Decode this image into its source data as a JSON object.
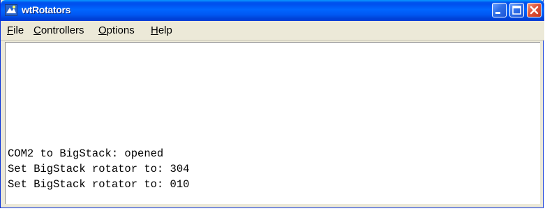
{
  "window": {
    "title": "wtRotators",
    "icon": "rotator-app-icon"
  },
  "title_buttons": {
    "minimize": "minimize-icon",
    "maximize": "maximize-icon",
    "close": "close-icon"
  },
  "menu": {
    "items": [
      {
        "mnemonic": "F",
        "rest": "ile"
      },
      {
        "mnemonic": "C",
        "rest": "ontrollers"
      },
      {
        "mnemonic": "O",
        "rest": "ptions"
      },
      {
        "mnemonic": "H",
        "rest": "elp"
      }
    ]
  },
  "log": {
    "lines": [
      "COM2 to BigStack: opened",
      "Set BigStack rotator to: 304",
      "Set BigStack rotator to: 010"
    ]
  },
  "colors": {
    "titlebar": "#0058f3",
    "close_button": "#e0533a",
    "menubar": "#ece9d8"
  }
}
